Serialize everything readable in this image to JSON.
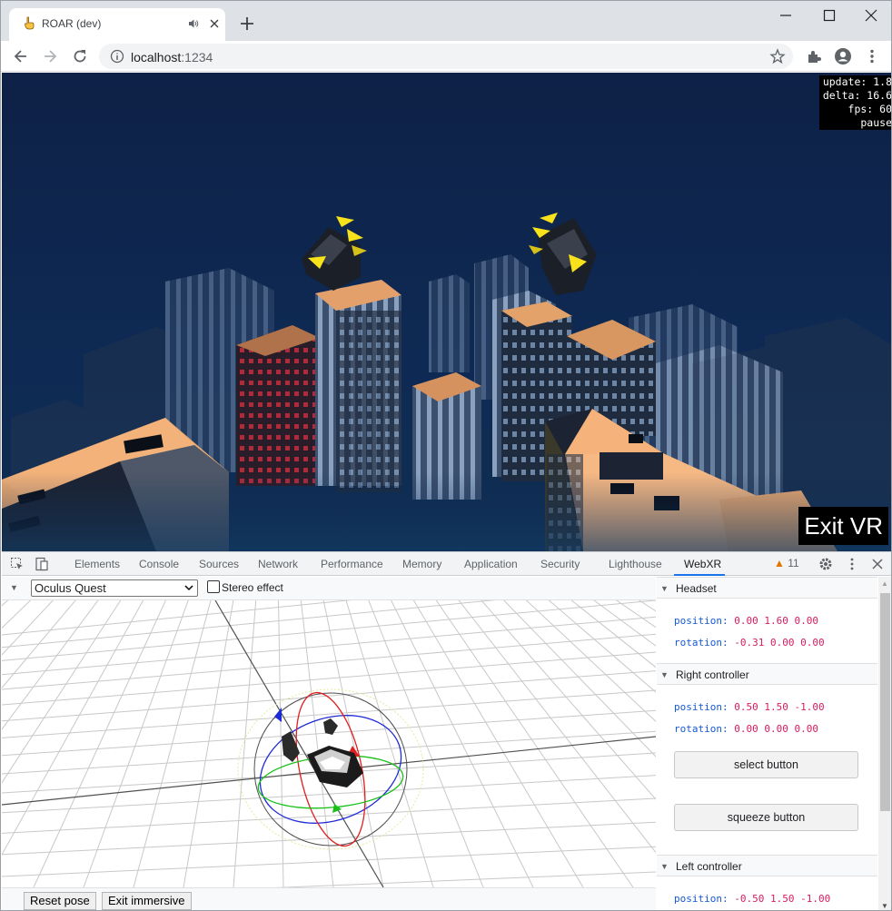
{
  "browser": {
    "tab_title": "ROAR (dev)",
    "url_host": "localhost",
    "url_port": ":1234",
    "icons": [
      "hand-favicon-icon",
      "speaker-icon",
      "close-tab-icon",
      "new-tab-icon",
      "minimize-icon",
      "maximize-icon",
      "close-window-icon",
      "back-icon",
      "forward-icon",
      "reload-icon",
      "info-icon",
      "bookmark-star-icon",
      "extensions-icon",
      "profile-icon",
      "menu-icon"
    ]
  },
  "scene": {
    "stats": [
      "update: 1.8",
      "delta: 16.6",
      "fps: 60",
      "pause"
    ],
    "exit_vr_label": "Exit VR",
    "colors": {
      "sky": "#0e2147",
      "building_lit": "#f0b078",
      "building_dark": "#1a2233",
      "claw_tip": "#f7e21b"
    }
  },
  "devtools": {
    "tabs": [
      "Elements",
      "Console",
      "Sources",
      "Network",
      "Performance",
      "Memory",
      "Application",
      "Security",
      "Lighthouse",
      "WebXR"
    ],
    "active_tab": "WebXR",
    "warnings_count": "11",
    "accent": "#1a73e8"
  },
  "webxr": {
    "device_select": "Oculus Quest",
    "stereo_label": "Stereo effect",
    "stereo_checked": false,
    "reset_pose_label": "Reset pose",
    "exit_immersive_label": "Exit immersive",
    "headset": {
      "title": "Headset",
      "position_label": "position:",
      "position_value": "0.00 1.60 0.00",
      "rotation_label": "rotation:",
      "rotation_value": "-0.31 0.00 0.00"
    },
    "right_controller": {
      "title": "Right controller",
      "position_label": "position:",
      "position_value": "0.50 1.50 -1.00",
      "rotation_label": "rotation:",
      "rotation_value": "0.00 0.00 0.00",
      "select_label": "select button",
      "squeeze_label": "squeeze button"
    },
    "left_controller": {
      "title": "Left controller",
      "position_label": "position:",
      "position_value": "-0.50 1.50 -1.00"
    }
  }
}
